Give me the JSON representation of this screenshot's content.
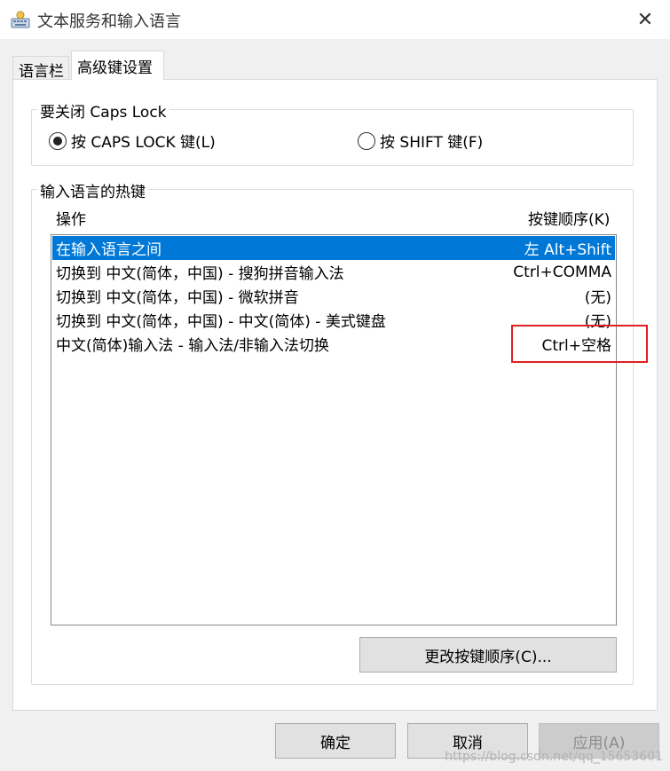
{
  "window": {
    "title": "文本服务和输入语言",
    "close_glyph": "✕"
  },
  "tabs": [
    {
      "label": "语言栏"
    },
    {
      "label": "高级键设置"
    }
  ],
  "caps_lock_group": {
    "legend": "要关闭 Caps Lock",
    "options": [
      {
        "label": "按 CAPS LOCK 键(L)",
        "checked": true
      },
      {
        "label": "按 SHIFT 键(F)",
        "checked": false
      }
    ]
  },
  "hotkeys_group": {
    "legend": "输入语言的热键",
    "columns": {
      "action": "操作",
      "key_sequence": "按键顺序(K)"
    },
    "rows": [
      {
        "action": "在输入语言之间",
        "keys": "左 Alt+Shift",
        "selected": true
      },
      {
        "action": "切换到 中文(简体，中国) - 搜狗拼音输入法",
        "keys": "Ctrl+COMMA",
        "selected": false
      },
      {
        "action": "切换到 中文(简体，中国) - 微软拼音",
        "keys": "(无)",
        "selected": false
      },
      {
        "action": "切换到 中文(简体，中国) - 中文(简体) - 美式键盘",
        "keys": "(无)",
        "selected": false
      },
      {
        "action": "中文(简体)输入法 - 输入法/非输入法切换",
        "keys": "Ctrl+空格",
        "selected": false
      }
    ],
    "change_button": "更改按键顺序(C)..."
  },
  "footer": {
    "ok": "确定",
    "cancel": "取消",
    "apply": "应用(A)"
  },
  "watermark": "https://blog.csdn.net/qq_15653601",
  "colors": {
    "selection": "#0078d7",
    "highlight_box": "#e02020"
  }
}
